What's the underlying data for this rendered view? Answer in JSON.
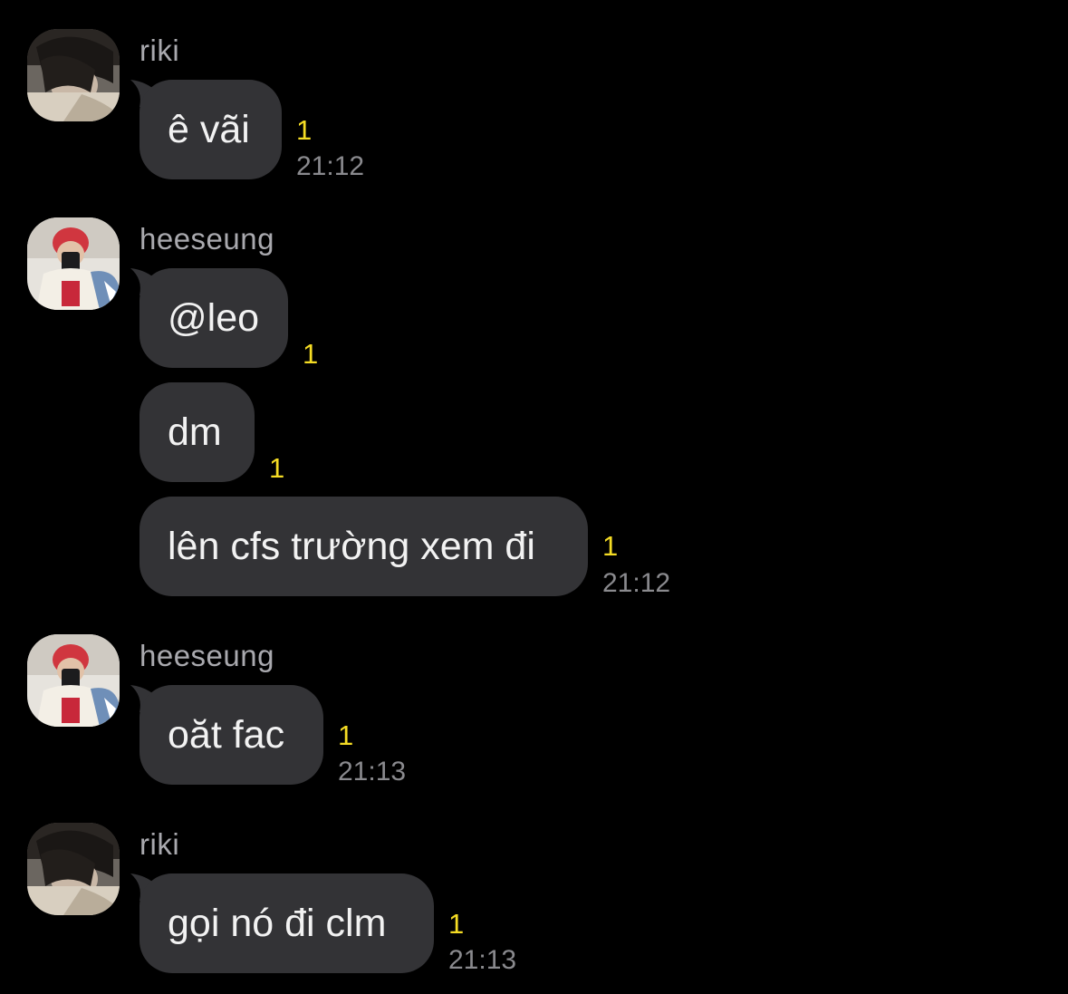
{
  "chat": {
    "groups": [
      {
        "sender": "riki",
        "avatar": "riki-avatar",
        "messages": [
          {
            "text": "ê vãi",
            "unread": "1",
            "time": "21:12"
          }
        ]
      },
      {
        "sender": "heeseung",
        "avatar": "heeseung-avatar",
        "messages": [
          {
            "text": "@leo",
            "unread": "1",
            "time": ""
          },
          {
            "text": "dm",
            "unread": "1",
            "time": ""
          },
          {
            "text": "lên cfs trường xem đi",
            "unread": "1",
            "time": "21:12"
          }
        ]
      },
      {
        "sender": "heeseung",
        "avatar": "heeseung-avatar",
        "messages": [
          {
            "text": "oăt fac",
            "unread": "1",
            "time": "21:13"
          }
        ]
      },
      {
        "sender": "riki",
        "avatar": "riki-avatar",
        "messages": [
          {
            "text": "gọi nó đi clm",
            "unread": "1",
            "time": "21:13"
          }
        ]
      }
    ]
  },
  "colors": {
    "background": "#000000",
    "bubble": "#333336",
    "bubble_text": "#f2f2f2",
    "unread_count": "#f5dc24",
    "timestamp": "#8a8a8e",
    "sender_name": "#a9a9ae"
  }
}
